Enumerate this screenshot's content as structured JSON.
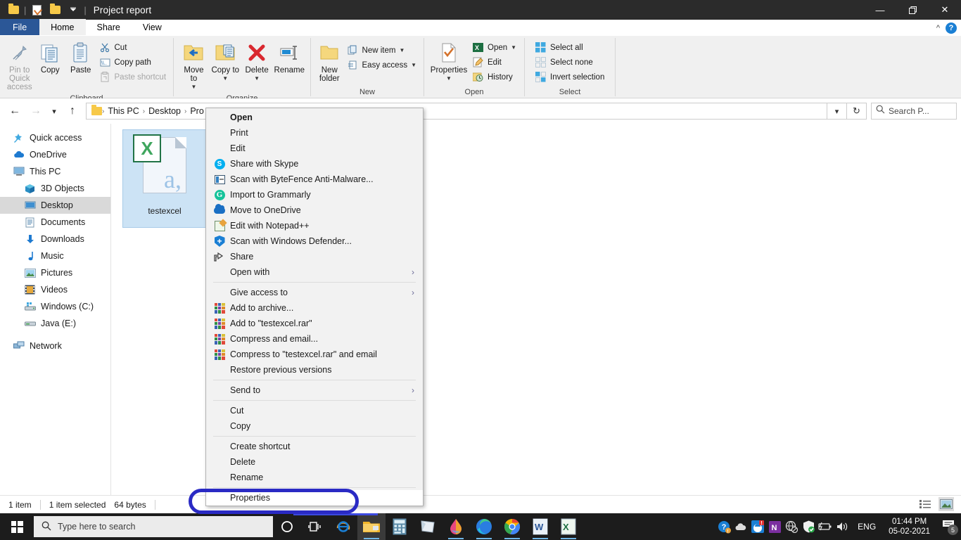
{
  "window": {
    "title": "Project report",
    "quick_access": [
      "folder-icon",
      "properties-icon",
      "folder-icon",
      "customize-chevron"
    ],
    "minimize": "—",
    "maximize": "❐",
    "close": "✕"
  },
  "tabs": [
    {
      "label": "File",
      "active": false
    },
    {
      "label": "Home",
      "active": true
    },
    {
      "label": "Share",
      "active": false
    },
    {
      "label": "View",
      "active": false
    }
  ],
  "ribbon": {
    "collapse_icon": "chevron-up-icon",
    "help_icon": "?",
    "groups": [
      {
        "name": "Clipboard",
        "label": "Clipboard",
        "big": [
          {
            "label": "Pin to Quick access",
            "icon": "pin-icon",
            "dim": true
          },
          {
            "label": "Copy",
            "icon": "copy-icon",
            "dim": false
          },
          {
            "label": "Paste",
            "icon": "paste-icon",
            "dim": false
          }
        ],
        "small": [
          {
            "label": "Cut",
            "icon": "scissors-icon",
            "dim": false
          },
          {
            "label": "Copy path",
            "icon": "copy-path-icon",
            "dim": false
          },
          {
            "label": "Paste shortcut",
            "icon": "paste-shortcut-icon",
            "dim": true
          }
        ]
      },
      {
        "name": "Organize",
        "label": "Organize",
        "big": [
          {
            "label": "Move to",
            "icon": "move-to-icon",
            "caret": true
          },
          {
            "label": "Copy to",
            "icon": "copy-to-icon",
            "caret": true
          },
          {
            "label": "Delete",
            "icon": "delete-icon",
            "caret": true
          },
          {
            "label": "Rename",
            "icon": "rename-icon",
            "caret": false
          }
        ]
      },
      {
        "name": "New",
        "label": "New",
        "big": [
          {
            "label": "New folder",
            "icon": "new-folder-icon"
          }
        ],
        "small": [
          {
            "label": "New item",
            "icon": "new-item-icon",
            "caret": true
          },
          {
            "label": "Easy access",
            "icon": "easy-access-icon",
            "caret": true
          }
        ]
      },
      {
        "name": "Open",
        "label": "Open",
        "big": [
          {
            "label": "Properties",
            "icon": "properties-icon",
            "caret": true
          }
        ],
        "small": [
          {
            "label": "Open",
            "icon": "excel-icon",
            "caret": true
          },
          {
            "label": "Edit",
            "icon": "edit-pencil-icon",
            "caret": false
          },
          {
            "label": "History",
            "icon": "history-icon",
            "caret": false
          }
        ]
      },
      {
        "name": "Select",
        "label": "Select",
        "small": [
          {
            "label": "Select all",
            "icon": "select-all-icon"
          },
          {
            "label": "Select none",
            "icon": "select-none-icon"
          },
          {
            "label": "Invert selection",
            "icon": "invert-selection-icon"
          }
        ]
      }
    ]
  },
  "addressbar": {
    "back_icon": "←",
    "forward_icon": "→",
    "recent_icon": "˅",
    "up_icon": "↑",
    "breadcrumbs": [
      "This PC",
      "Desktop",
      "Pro"
    ],
    "separator": "›",
    "dropdown_icon": "˅",
    "refresh_icon": "↻",
    "search_icon": "search-icon",
    "search_placeholder": "Search P..."
  },
  "navpane": [
    {
      "label": "Quick access",
      "icon": "star-pin-icon",
      "indent": false,
      "selected": false
    },
    {
      "label": "OneDrive",
      "icon": "cloud-icon",
      "indent": false,
      "selected": false
    },
    {
      "label": "This PC",
      "icon": "monitor-icon",
      "indent": false,
      "selected": false
    },
    {
      "label": "3D Objects",
      "icon": "cube-icon",
      "indent": true,
      "selected": false
    },
    {
      "label": "Desktop",
      "icon": "desktop-icon",
      "indent": true,
      "selected": true
    },
    {
      "label": "Documents",
      "icon": "documents-icon",
      "indent": true,
      "selected": false
    },
    {
      "label": "Downloads",
      "icon": "download-arrow-icon",
      "indent": true,
      "selected": false
    },
    {
      "label": "Music",
      "icon": "music-note-icon",
      "indent": true,
      "selected": false
    },
    {
      "label": "Pictures",
      "icon": "pictures-icon",
      "indent": true,
      "selected": false
    },
    {
      "label": "Videos",
      "icon": "videos-icon",
      "indent": true,
      "selected": false
    },
    {
      "label": "Windows (C:)",
      "icon": "hard-drive-icon",
      "indent": true,
      "selected": false
    },
    {
      "label": "Java (E:)",
      "icon": "drive-icon",
      "indent": true,
      "selected": false
    },
    {
      "label": "Network",
      "icon": "network-icon",
      "indent": false,
      "selected": false
    }
  ],
  "file": {
    "name": "testexcel",
    "icon": "excel-document-icon",
    "selected": true
  },
  "context_menu": {
    "items": [
      {
        "label": "Open",
        "icon": null,
        "bold": true,
        "arrow": false
      },
      {
        "label": "Print",
        "icon": null,
        "bold": false,
        "arrow": false
      },
      {
        "label": "Edit",
        "icon": null,
        "bold": false,
        "arrow": false
      },
      {
        "label": "Share with Skype",
        "icon": "skype-icon",
        "bold": false,
        "arrow": false
      },
      {
        "label": "Scan with ByteFence Anti-Malware...",
        "icon": "bytefence-icon",
        "bold": false,
        "arrow": false
      },
      {
        "label": "Import to Grammarly",
        "icon": "grammarly-icon",
        "bold": false,
        "arrow": false
      },
      {
        "label": "Move to OneDrive",
        "icon": "onedrive-icon",
        "bold": false,
        "arrow": false
      },
      {
        "label": "Edit with Notepad++",
        "icon": "notepadpp-icon",
        "bold": false,
        "arrow": false
      },
      {
        "label": "Scan with Windows Defender...",
        "icon": "windows-defender-icon",
        "bold": false,
        "arrow": false
      },
      {
        "label": "Share",
        "icon": "share-icon",
        "bold": false,
        "arrow": false
      },
      {
        "label": "Open with",
        "icon": null,
        "bold": false,
        "arrow": true
      },
      {
        "separator": true
      },
      {
        "label": "Give access to",
        "icon": null,
        "bold": false,
        "arrow": true
      },
      {
        "label": "Add to archive...",
        "icon": "winrar-icon",
        "bold": false,
        "arrow": false
      },
      {
        "label": "Add to \"testexcel.rar\"",
        "icon": "winrar-icon",
        "bold": false,
        "arrow": false
      },
      {
        "label": "Compress and email...",
        "icon": "winrar-icon",
        "bold": false,
        "arrow": false
      },
      {
        "label": "Compress to \"testexcel.rar\" and email",
        "icon": "winrar-icon",
        "bold": false,
        "arrow": false
      },
      {
        "label": "Restore previous versions",
        "icon": null,
        "bold": false,
        "arrow": false
      },
      {
        "separator": true
      },
      {
        "label": "Send to",
        "icon": null,
        "bold": false,
        "arrow": true
      },
      {
        "separator": true
      },
      {
        "label": "Cut",
        "icon": null,
        "bold": false,
        "arrow": false
      },
      {
        "label": "Copy",
        "icon": null,
        "bold": false,
        "arrow": false
      },
      {
        "separator": true
      },
      {
        "label": "Create shortcut",
        "icon": null,
        "bold": false,
        "arrow": false
      },
      {
        "label": "Delete",
        "icon": null,
        "bold": false,
        "arrow": false
      },
      {
        "label": "Rename",
        "icon": null,
        "bold": false,
        "arrow": false
      },
      {
        "separator": true
      },
      {
        "label": "Properties",
        "icon": null,
        "bold": false,
        "arrow": false,
        "highlighted": true
      }
    ]
  },
  "annotation": {
    "target": "Properties",
    "color": "#2a2ac4",
    "shape": "oval"
  },
  "statusbar": {
    "item_count": "1 item",
    "selection": "1 item selected",
    "size": "64 bytes",
    "view_details_icon": "details-view-icon",
    "view_large_icon": "large-icons-view-icon"
  },
  "taskbar": {
    "start_icon": "windows-logo-icon",
    "search_placeholder": "Type here to search",
    "search_icon": "search-icon",
    "cortana_icon": "cortana-circle-icon",
    "taskview_icon": "task-view-icon",
    "apps": [
      {
        "name": "internet-explorer-icon",
        "running": false,
        "active": false
      },
      {
        "name": "file-explorer-icon",
        "running": true,
        "active": true
      },
      {
        "name": "calculator-icon",
        "running": false,
        "active": false
      },
      {
        "name": "sticky-notes-icon",
        "running": false,
        "active": false
      },
      {
        "name": "paint-3d-icon",
        "running": true,
        "active": false
      },
      {
        "name": "microsoft-edge-icon",
        "running": true,
        "active": false
      },
      {
        "name": "google-chrome-icon",
        "running": true,
        "active": false
      },
      {
        "name": "microsoft-word-icon",
        "running": true,
        "active": false
      },
      {
        "name": "microsoft-excel-icon",
        "running": true,
        "active": false
      }
    ],
    "tray": [
      {
        "name": "get-help-icon"
      },
      {
        "name": "onedrive-cloud-icon"
      },
      {
        "name": "alert-icon"
      },
      {
        "name": "onenote-icon"
      },
      {
        "name": "network-disconnected-icon"
      },
      {
        "name": "windows-security-icon"
      },
      {
        "name": "battery-icon"
      },
      {
        "name": "volume-icon"
      }
    ],
    "language": "ENG",
    "time": "01:44 PM",
    "date": "05-02-2021",
    "notification_icon": "action-center-icon",
    "notification_count": "5"
  }
}
